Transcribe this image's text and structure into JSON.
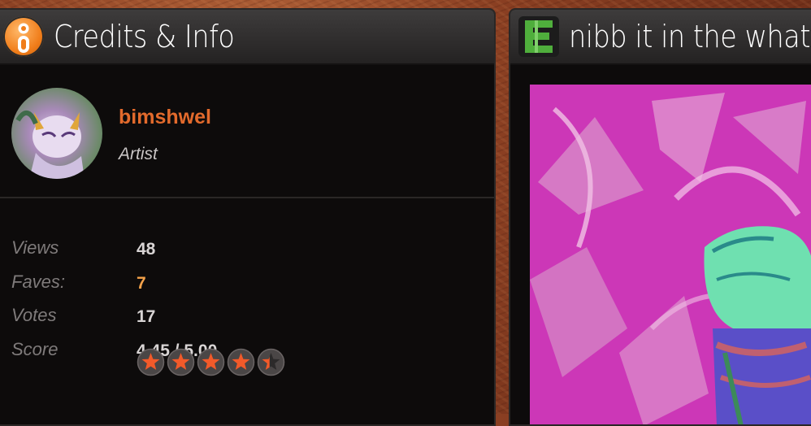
{
  "credits": {
    "title": "Credits & Info",
    "user": {
      "name": "bimshwel",
      "role": "Artist"
    },
    "stats": [
      {
        "label": "Views",
        "value": "48"
      },
      {
        "label": "Faves:",
        "value": "7"
      },
      {
        "label": "Votes",
        "value": "17"
      },
      {
        "label": "Score",
        "value": "4.45 / 5.00"
      }
    ],
    "rating": 4.45,
    "rating_max": 5
  },
  "artwork": {
    "title": "nibb it in the what",
    "rating_badge": "E"
  },
  "icons": {
    "credits_icon": "info-icon",
    "artwork_icon": "rating-e-icon",
    "star_icon": "star-icon"
  },
  "colors": {
    "accent_orange": "#e26a2c",
    "faves_orange": "#f4a24a",
    "rating_green": "#4fae3c",
    "art_background": "#cc37b7"
  }
}
